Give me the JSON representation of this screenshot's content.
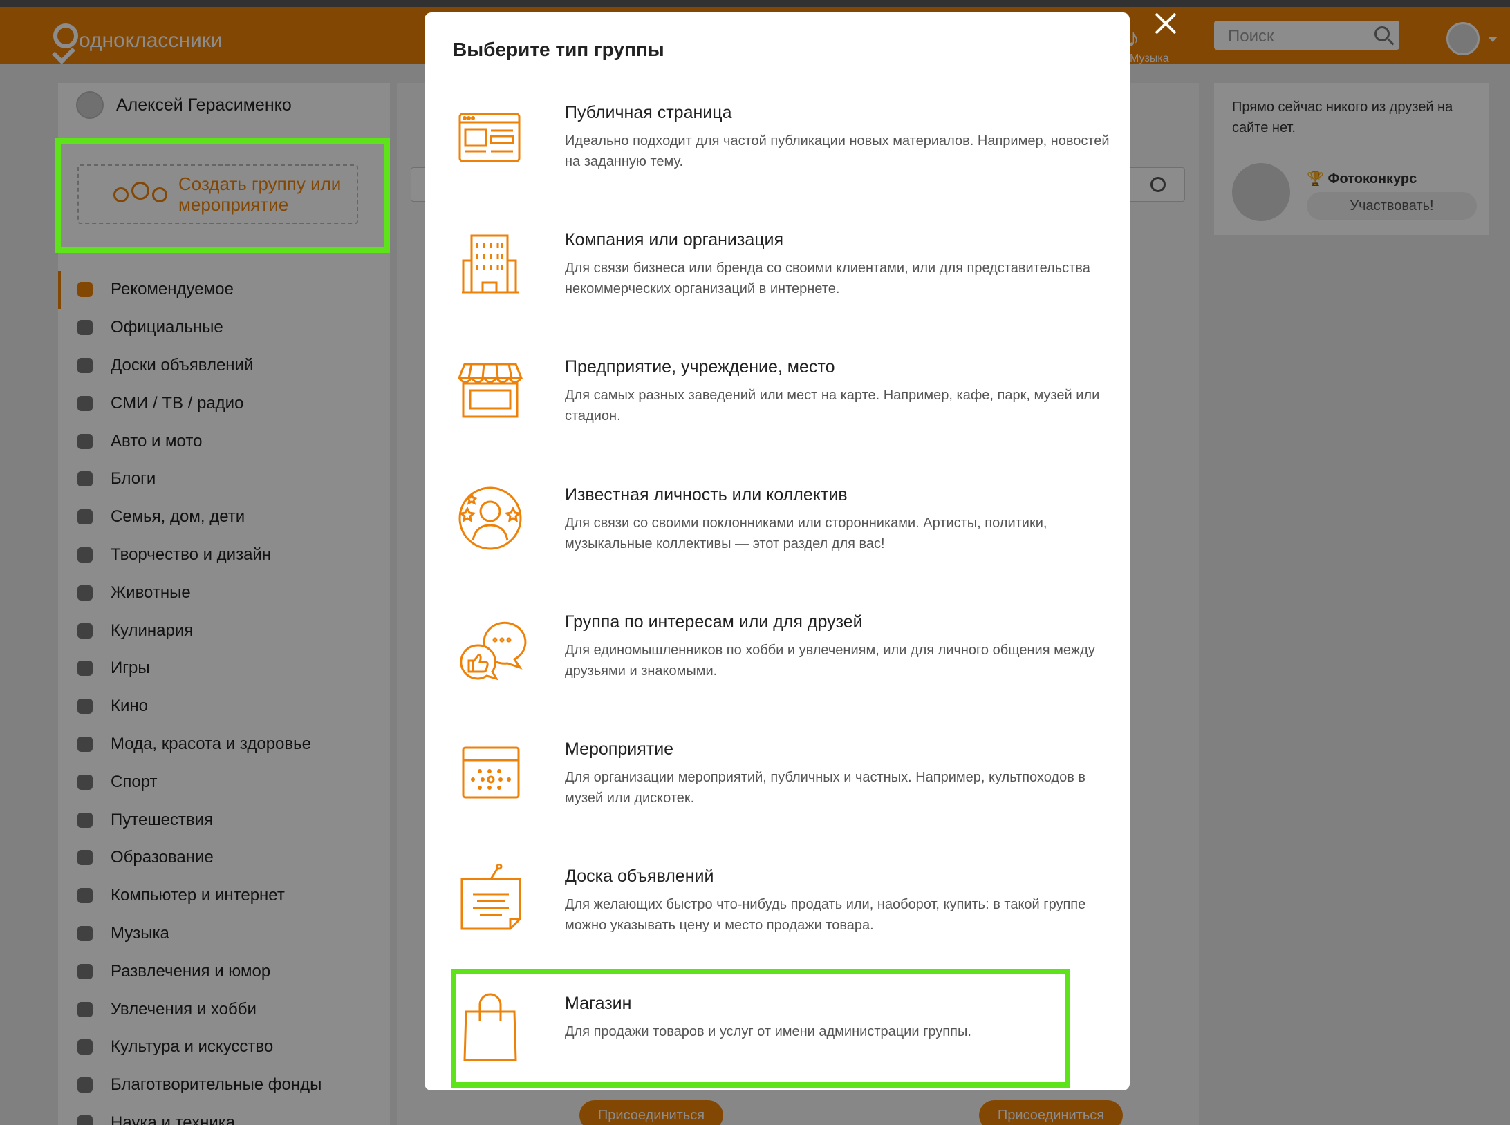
{
  "header": {
    "logo_text": "одноклассники",
    "search_placeholder": "Поиск",
    "music_label": "Музыка"
  },
  "sidebar": {
    "user_name": "Алексей Герасименко",
    "create_group": "Создать группу или мероприятие",
    "categories": [
      "Рекомендуемое",
      "Официальные",
      "Доски объявлений",
      "СМИ / ТВ / радио",
      "Авто и мото",
      "Блоги",
      "Семья, дом, дети",
      "Творчество и дизайн",
      "Животные",
      "Кулинария",
      "Игры",
      "Кино",
      "Мода, красота и здоровье",
      "Спорт",
      "Путешествия",
      "Образование",
      "Компьютер и интернет",
      "Музыка",
      "Развлечения и юмор",
      "Увлечения и хобби",
      "Культура и искусство",
      "Благотворительные фонды",
      "Наука и техника"
    ]
  },
  "right": {
    "friends_text": "Прямо сейчас никого из друзей на сайте нет.",
    "photo_contest": "Фотоконкурс",
    "participate": "Участвовать!"
  },
  "center": {
    "join_label": "Присоединиться"
  },
  "modal": {
    "title": "Выберите тип группы",
    "options": [
      {
        "icon": "public-page-icon",
        "title": "Публичная страница",
        "desc": "Идеально подходит для частой публикации новых материалов. Например, новостей на заданную тему."
      },
      {
        "icon": "company-building-icon",
        "title": "Компания или организация",
        "desc": "Для связи бизнеса или бренда со своими клиентами, или для представительства некоммерческих организаций в интернете."
      },
      {
        "icon": "storefront-icon",
        "title": "Предприятие, учреждение, место",
        "desc": "Для самых разных заведений или мест на карте. Например, кафе, парк, музей или стадион."
      },
      {
        "icon": "celebrity-icon",
        "title": "Известная личность или коллектив",
        "desc": "Для связи со своими поклонниками или сторонниками. Артисты, политики, музыкальные коллективы — этот раздел для вас!"
      },
      {
        "icon": "chat-bubbles-icon",
        "title": "Группа по интересам или для друзей",
        "desc": "Для единомышленников по хобби и увлечениям, или для личного общения между друзьями и знакомыми."
      },
      {
        "icon": "calendar-icon",
        "title": "Мероприятие",
        "desc": "Для организации мероприятий, публичных и частных. Например, культпоходов в музей или дискотек."
      },
      {
        "icon": "notice-board-icon",
        "title": "Доска объявлений",
        "desc": "Для желающих быстро что-нибудь продать или, наоборот, купить: в такой группе можно указывать цену и место продажи товара."
      },
      {
        "icon": "shopping-bag-icon",
        "title": "Магазин",
        "desc": "Для продажи товаров и услуг от имени администрации группы."
      }
    ]
  },
  "colors": {
    "brand": "#ee8208",
    "highlight": "#5ee21a"
  }
}
